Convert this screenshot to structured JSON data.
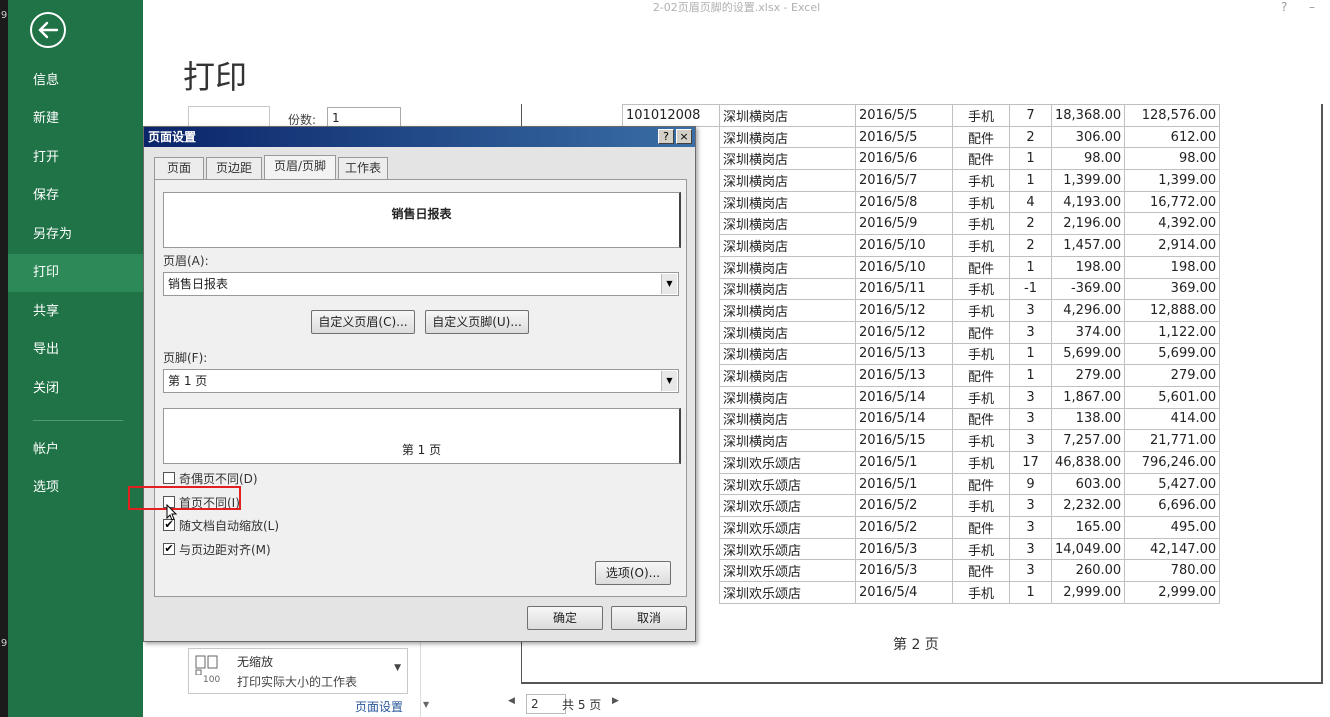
{
  "window": {
    "title": "2-02页眉页脚的设置.xlsx - Excel",
    "help": "?",
    "minimize": "–",
    "strip_top": "9",
    "strip_bottom": "9"
  },
  "sidebar": {
    "items": [
      {
        "label": "信息"
      },
      {
        "label": "新建"
      },
      {
        "label": "打开"
      },
      {
        "label": "保存"
      },
      {
        "label": "另存为"
      },
      {
        "label": "打印"
      },
      {
        "label": "共享"
      },
      {
        "label": "导出"
      },
      {
        "label": "关闭"
      },
      {
        "label": "帐户"
      },
      {
        "label": "选项"
      }
    ]
  },
  "print": {
    "title": "打印",
    "copies_label": "份数:",
    "copies_value": "1",
    "scaling_title": "无缩放",
    "scaling_desc": "打印实际大小的工作表",
    "scaling_icon": "100",
    "page_setup_link": "页面设置"
  },
  "preview": {
    "rows": [
      [
        "101012008",
        "深圳横岗店",
        "2016/5/5",
        "手机",
        "7",
        "18,368.00",
        "128,576.00"
      ],
      [
        "",
        "深圳横岗店",
        "2016/5/5",
        "配件",
        "2",
        "306.00",
        "612.00"
      ],
      [
        "",
        "深圳横岗店",
        "2016/5/6",
        "配件",
        "1",
        "98.00",
        "98.00"
      ],
      [
        "",
        "深圳横岗店",
        "2016/5/7",
        "手机",
        "1",
        "1,399.00",
        "1,399.00"
      ],
      [
        "",
        "深圳横岗店",
        "2016/5/8",
        "手机",
        "4",
        "4,193.00",
        "16,772.00"
      ],
      [
        "",
        "深圳横岗店",
        "2016/5/9",
        "手机",
        "2",
        "2,196.00",
        "4,392.00"
      ],
      [
        "",
        "深圳横岗店",
        "2016/5/10",
        "手机",
        "2",
        "1,457.00",
        "2,914.00"
      ],
      [
        "",
        "深圳横岗店",
        "2016/5/10",
        "配件",
        "1",
        "198.00",
        "198.00"
      ],
      [
        "",
        "深圳横岗店",
        "2016/5/11",
        "手机",
        "-1",
        "-369.00",
        "369.00"
      ],
      [
        "",
        "深圳横岗店",
        "2016/5/12",
        "手机",
        "3",
        "4,296.00",
        "12,888.00"
      ],
      [
        "",
        "深圳横岗店",
        "2016/5/12",
        "配件",
        "3",
        "374.00",
        "1,122.00"
      ],
      [
        "",
        "深圳横岗店",
        "2016/5/13",
        "手机",
        "1",
        "5,699.00",
        "5,699.00"
      ],
      [
        "",
        "深圳横岗店",
        "2016/5/13",
        "配件",
        "1",
        "279.00",
        "279.00"
      ],
      [
        "",
        "深圳横岗店",
        "2016/5/14",
        "手机",
        "3",
        "1,867.00",
        "5,601.00"
      ],
      [
        "",
        "深圳横岗店",
        "2016/5/14",
        "配件",
        "3",
        "138.00",
        "414.00"
      ],
      [
        "",
        "深圳横岗店",
        "2016/5/15",
        "手机",
        "3",
        "7,257.00",
        "21,771.00"
      ],
      [
        "",
        "深圳欢乐颂店",
        "2016/5/1",
        "手机",
        "17",
        "46,838.00",
        "796,246.00"
      ],
      [
        "",
        "深圳欢乐颂店",
        "2016/5/1",
        "配件",
        "9",
        "603.00",
        "5,427.00"
      ],
      [
        "",
        "深圳欢乐颂店",
        "2016/5/2",
        "手机",
        "3",
        "2,232.00",
        "6,696.00"
      ],
      [
        "",
        "深圳欢乐颂店",
        "2016/5/2",
        "配件",
        "3",
        "165.00",
        "495.00"
      ],
      [
        "",
        "深圳欢乐颂店",
        "2016/5/3",
        "手机",
        "3",
        "14,049.00",
        "42,147.00"
      ],
      [
        "",
        "深圳欢乐颂店",
        "2016/5/3",
        "配件",
        "3",
        "260.00",
        "780.00"
      ],
      [
        "",
        "深圳欢乐颂店",
        "2016/5/4",
        "手机",
        "1",
        "2,999.00",
        "2,999.00"
      ]
    ],
    "footer": "第 2 页",
    "page_current": "2",
    "page_total": "共 5 页"
  },
  "dialog": {
    "title": "页面设置",
    "help_btn": "?",
    "close_btn": "×",
    "tabs": [
      "页面",
      "页边距",
      "页眉/页脚",
      "工作表"
    ],
    "header_preview": "销售日报表",
    "header_label": "页眉(A):",
    "header_value": "销售日报表",
    "custom_header_btn": "自定义页眉(C)...",
    "custom_footer_btn": "自定义页脚(U)...",
    "footer_label": "页脚(F):",
    "footer_value": "第 1 页",
    "footer_preview": "第 1 页",
    "checkboxes": [
      {
        "label": "奇偶页不同(D)",
        "checked": false
      },
      {
        "label": "首页不同(I)",
        "checked": false
      },
      {
        "label": "随文档自动缩放(L)",
        "checked": true
      },
      {
        "label": "与页边距对齐(M)",
        "checked": true
      }
    ],
    "options_btn": "选项(O)...",
    "ok_btn": "确定",
    "cancel_btn": "取消"
  },
  "colors": {
    "sidebar_bg": "#1f7346",
    "sidebar_active": "#2d8a58",
    "highlight_box": "#e32020",
    "dialog_title_bg": "#0a246a"
  }
}
